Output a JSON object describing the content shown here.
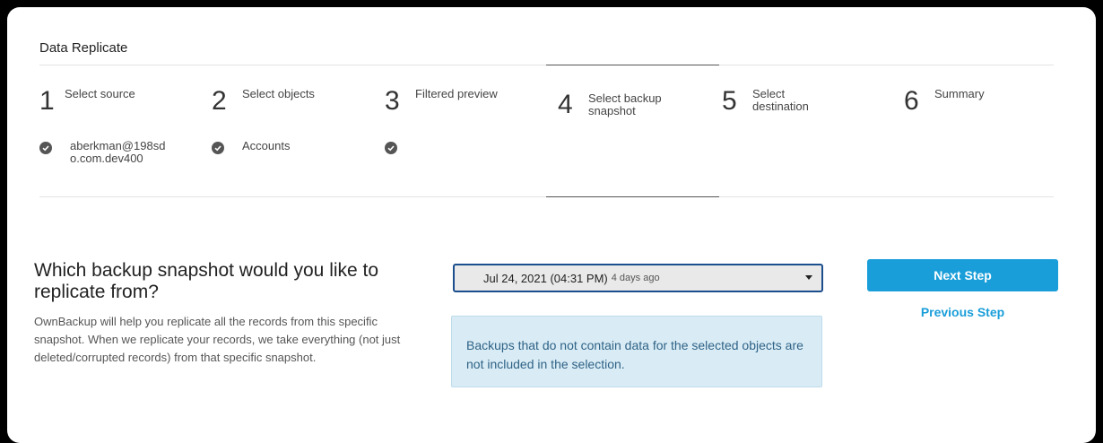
{
  "app": {
    "title": "Data Replicate"
  },
  "steps": [
    {
      "number": "1",
      "label": "Select source",
      "status": "aberkman@198sdo.com.dev400",
      "completed": true
    },
    {
      "number": "2",
      "label": "Select objects",
      "status": "Accounts",
      "completed": true
    },
    {
      "number": "3",
      "label": "Filtered preview",
      "status": "",
      "completed": true
    },
    {
      "number": "4",
      "label": "Select backup snapshot",
      "status": "",
      "completed": false,
      "active": true
    },
    {
      "number": "5",
      "label": "Select destination",
      "status": "",
      "completed": false
    },
    {
      "number": "6",
      "label": "Summary",
      "status": "",
      "completed": false
    }
  ],
  "main": {
    "question": "Which backup snapshot would you like to replicate from?",
    "description": "OwnBackup will help you replicate all the records from this specific snapshot. When we replicate your records, we take everything (not just deleted/corrupted records) from that specific snapshot.",
    "snapshot_select": {
      "value": "Jul 24, 2021 (04:31 PM)",
      "relative": "4 days ago"
    },
    "info_text": "Backups that do not contain data for the selected objects are not included in the selection."
  },
  "actions": {
    "next_label": "Next Step",
    "previous_label": "Previous Step"
  },
  "colors": {
    "accent": "#1a9ed9",
    "info_bg": "#d9ecf5",
    "info_text": "#2f6286"
  }
}
